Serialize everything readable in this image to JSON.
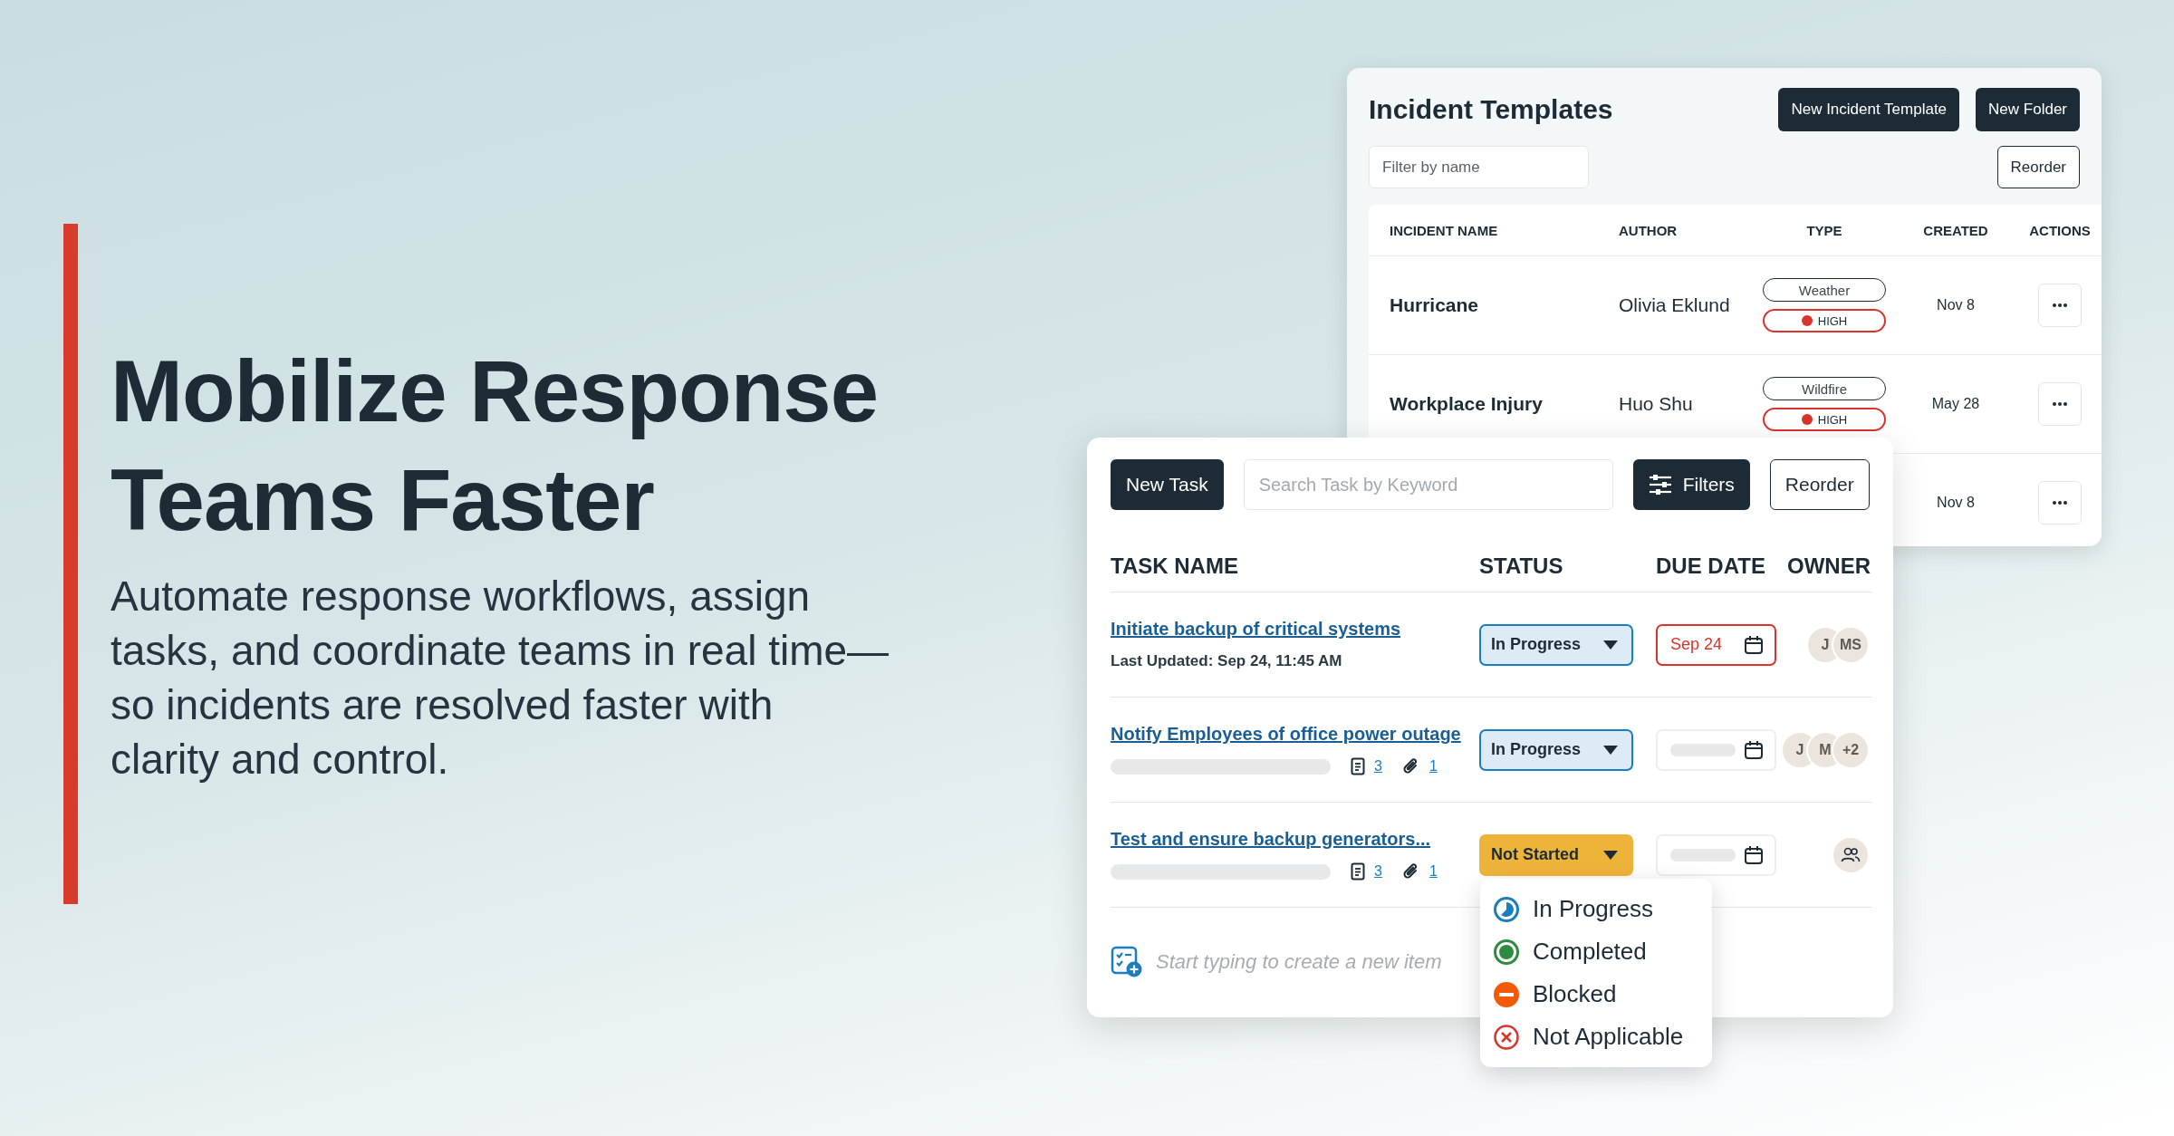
{
  "hero": {
    "heading": "Mobilize Response Teams Faster",
    "body": "Automate response workflows, assign tasks, and coordinate teams in real time—so incidents are resolved faster with clarity and control."
  },
  "incident_templates": {
    "title": "Incident Templates",
    "buttons": [
      "New Incident Template",
      "New Folder"
    ],
    "filter": {
      "placeholder": "Filter by name"
    },
    "reorder": "Reorder",
    "columns": [
      "INCIDENT NAME",
      "AUTHOR",
      "TYPE",
      "CREATED",
      "ACTIONS"
    ],
    "rows": [
      {
        "name": "Hurricane",
        "author": "Olivia Eklund",
        "type": "Weather",
        "severity": "HIGH",
        "created": "Nov 8"
      },
      {
        "name": "Workplace Injury",
        "author": "Huo Shu",
        "type": "Wildfire",
        "severity": "HIGH",
        "created": "May 28"
      },
      {
        "created": "Nov 8"
      }
    ]
  },
  "tasks": {
    "new_task": "New Task",
    "search": {
      "placeholder": "Search Task by Keyword"
    },
    "filters": "Filters",
    "reorder": "Reorder",
    "columns": [
      "TASK NAME",
      "STATUS",
      "DUE DATE",
      "OWNER"
    ],
    "rows": [
      {
        "name": "Initiate backup of critical systems",
        "last_updated": "Last Updated: Sep 24, 11:45 AM",
        "status": {
          "kind": "in_progress",
          "label": "In Progress"
        },
        "due": {
          "kind": "date",
          "label": "Sep 24",
          "overdue": true
        },
        "owners": {
          "kind": "avatars",
          "items": [
            "J",
            "MS"
          ]
        }
      },
      {
        "name": "Notify Employees of office power outage",
        "notes": "3",
        "attachments": "1",
        "status": {
          "kind": "in_progress",
          "label": "In Progress"
        },
        "due": {
          "kind": "empty"
        },
        "owners": {
          "kind": "avatars",
          "items": [
            "J",
            "M",
            "+2"
          ]
        }
      },
      {
        "name": "Test and ensure backup generators...",
        "notes": "3",
        "attachments": "1",
        "status": {
          "kind": "not_started",
          "label": "Not Started"
        },
        "due": {
          "kind": "empty"
        },
        "owners": {
          "kind": "unassigned"
        }
      }
    ],
    "new_item": {
      "placeholder": "Start typing to create a new item"
    }
  },
  "status_menu": [
    {
      "label": "In Progress",
      "kind": "in_progress"
    },
    {
      "label": "Completed",
      "kind": "completed"
    },
    {
      "label": "Blocked",
      "kind": "blocked"
    },
    {
      "label": "Not Applicable",
      "kind": "not_applicable"
    }
  ]
}
